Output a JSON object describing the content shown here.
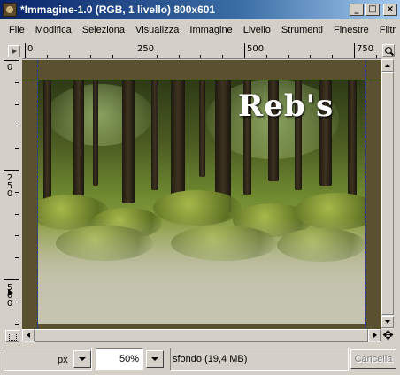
{
  "window": {
    "title": "*Immagine-1.0 (RGB, 1 livello) 800x601",
    "minimize_glyph": "_",
    "maximize_glyph": "□",
    "close_glyph": "×"
  },
  "menu": {
    "items": [
      {
        "underline": "F",
        "rest": "ile"
      },
      {
        "underline": "M",
        "rest": "odifica"
      },
      {
        "underline": "S",
        "rest": "eleziona"
      },
      {
        "underline": "V",
        "rest": "isualizza"
      },
      {
        "underline": "I",
        "rest": "mmagine"
      },
      {
        "underline": "L",
        "rest": "ivello"
      },
      {
        "underline": "S",
        "rest": "trumenti"
      },
      {
        "underline": "F",
        "rest": "inestre"
      },
      {
        "underline": "",
        "rest": "Filtr"
      }
    ]
  },
  "ruler": {
    "horizontal_labels": [
      "0",
      "250",
      "500",
      "750"
    ],
    "vertical_labels": [
      "0",
      "250",
      "500"
    ]
  },
  "canvas": {
    "logo_text": "Reb's"
  },
  "statusbar": {
    "unit": "px",
    "zoom": "50%",
    "status": "sfondo (19,4 MB)",
    "cancel_label": "Cancella"
  },
  "icons": {
    "navigate": "✥"
  }
}
